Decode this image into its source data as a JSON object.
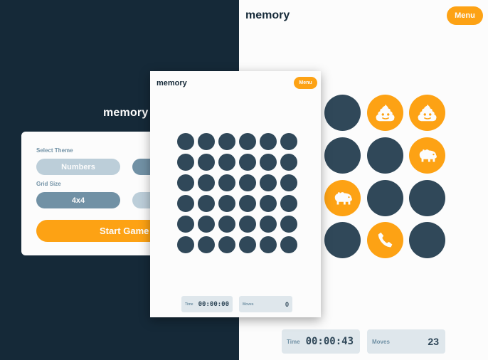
{
  "setup": {
    "logo": "memory",
    "theme_label": "Select Theme",
    "theme_selected": "Numbers",
    "grid_label": "Grid Size",
    "grid_selected": "4x4",
    "start_button": "Start Game"
  },
  "game_large": {
    "logo": "memory",
    "menu_button": "Menu",
    "tiles": [
      {
        "state": "hidden",
        "icon": ""
      },
      {
        "state": "open",
        "icon": "poop-icon"
      },
      {
        "state": "open",
        "icon": "poop-icon"
      },
      {
        "state": "hidden",
        "icon": ""
      },
      {
        "state": "hidden",
        "icon": ""
      },
      {
        "state": "open",
        "icon": "hippo-icon"
      },
      {
        "state": "open",
        "icon": "hippo-icon"
      },
      {
        "state": "hidden",
        "icon": ""
      },
      {
        "state": "hidden",
        "icon": ""
      },
      {
        "state": "hidden",
        "icon": ""
      },
      {
        "state": "open",
        "icon": "phone-icon"
      },
      {
        "state": "hidden",
        "icon": ""
      }
    ],
    "time_label": "Time",
    "time_value": "00:00:43",
    "moves_label": "Moves",
    "moves_value": "23"
  },
  "game_phone": {
    "logo": "memory",
    "menu_button": "Menu",
    "grid_rows": 6,
    "grid_cols": 6,
    "time_label": "Time",
    "time_value": "00:00:00",
    "moves_label": "Moves",
    "moves_value": "0"
  },
  "colors": {
    "dark_navy": "#152938",
    "tile_hidden": "#304859",
    "orange": "#fda214",
    "pill_selected": "#7191a5",
    "pill_unselected": "#bcced9",
    "stat_bg": "#dfe7ec"
  }
}
